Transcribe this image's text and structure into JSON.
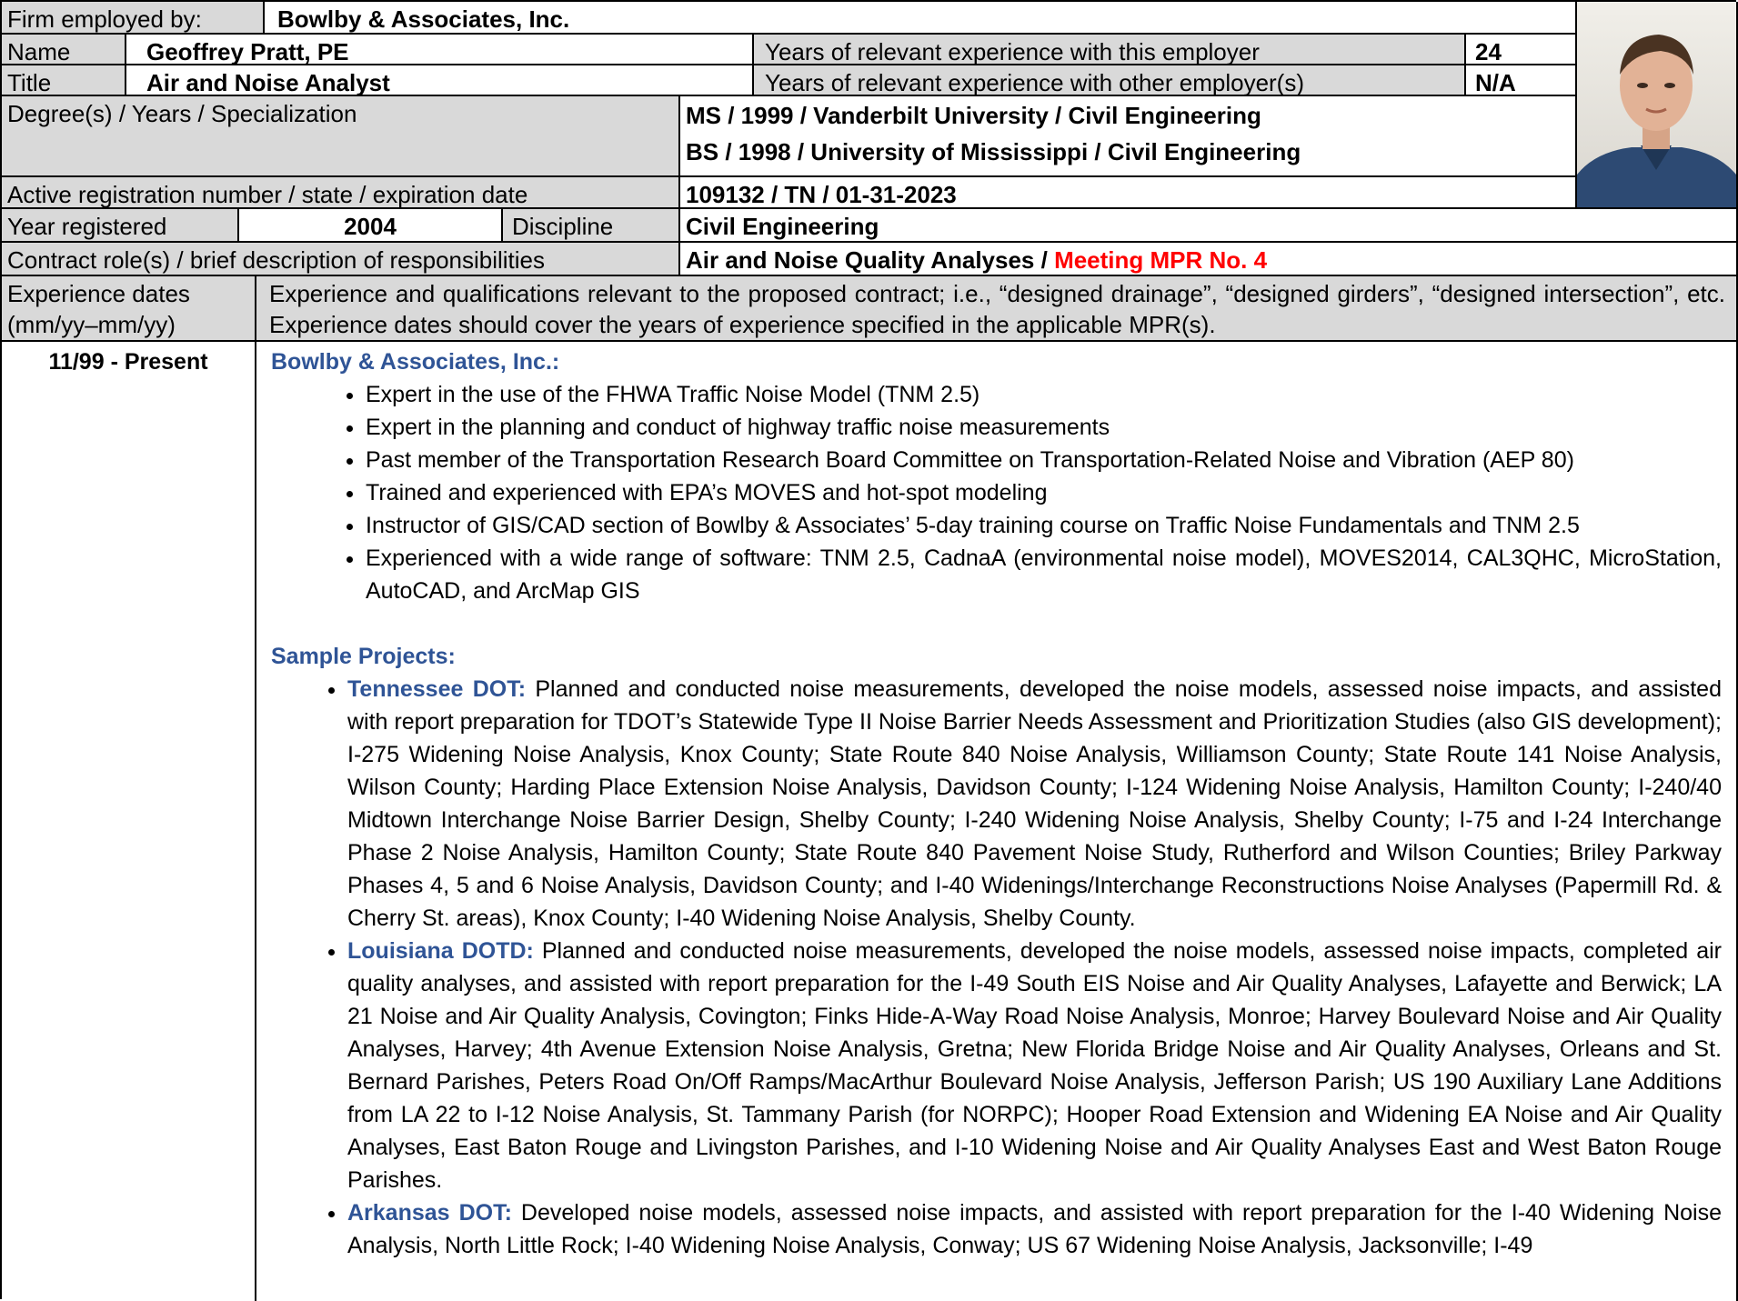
{
  "header": {
    "firm_label": "Firm employed by:",
    "firm_value": "Bowlby & Associates, Inc.",
    "name_label": "Name",
    "name_value": "Geoffrey Pratt, PE",
    "years_this_label": "Years of relevant experience with this employer",
    "years_this_value": "24",
    "title_label": "Title",
    "title_value": "Air and Noise Analyst",
    "years_other_label": "Years of relevant experience with other employer(s)",
    "years_other_value": "N/A",
    "degree_label": "Degree(s) / Years / Specialization",
    "degree_1": "MS / 1999 / Vanderbilt University / Civil Engineering",
    "degree_2": "BS / 1998 / University of Mississippi / Civil Engineering",
    "registration_label": "Active registration number / state / expiration date",
    "registration_value": "109132 / TN / 01-31-2023",
    "year_registered_label": "Year registered",
    "year_registered_value": "2004",
    "discipline_label": "Discipline",
    "discipline_value": "Civil Engineering",
    "role_label": "Contract role(s) / brief description of responsibilities",
    "role_value": "Air and Noise Quality Analyses / ",
    "role_mpr": "Meeting MPR No. 4",
    "exp_dates_label": "Experience dates (mm/yy–mm/yy)",
    "exp_desc_label": "Experience and qualifications relevant to the proposed contract; i.e., “designed drainage”, “designed girders”, “designed intersection”, etc.  Experience dates should cover the years of experience specified in the applicable MPR(s)."
  },
  "experience": {
    "dates": "11/99 - Present",
    "employer": "Bowlby & Associates, Inc.:",
    "bullets": [
      "Expert in the use of the FHWA Traffic Noise Model (TNM 2.5)",
      "Expert in the planning and conduct of highway traffic noise measurements",
      "Past member of the Transportation Research Board Committee on Transportation-Related Noise and Vibration (AEP 80)",
      "Trained and experienced with EPA’s MOVES and hot-spot modeling",
      "Instructor of GIS/CAD section of Bowlby & Associates’ 5-day training course on Traffic Noise Fundamentals and TNM 2.5",
      "Experienced with a wide range of software: TNM 2.5, CadnaA (environmental noise model), MOVES2014, CAL3QHC, MicroStation, AutoCAD, and ArcMap GIS"
    ],
    "sample_heading": "Sample Projects:",
    "projects": [
      {
        "client": "Tennessee DOT:",
        "text": " Planned and conducted noise measurements, developed the noise models, assessed noise impacts, and assisted with report preparation for TDOT’s Statewide Type II Noise Barrier Needs Assessment and Prioritization Studies (also GIS development); I-275 Widening Noise Analysis, Knox County; State Route 840 Noise Analysis, Williamson County; State Route 141 Noise Analysis, Wilson County;  Harding Place Extension Noise Analysis, Davidson County; I-124 Widening Noise Analysis, Hamilton County; I-240/40 Midtown Interchange Noise Barrier Design, Shelby County; I-240 Widening Noise Analysis, Shelby County; I-75 and I-24 Interchange Phase 2 Noise Analysis, Hamilton County; State Route 840 Pavement Noise Study, Rutherford and Wilson Counties; Briley Parkway Phases 4, 5 and 6 Noise Analysis, Davidson County; and I-40 Widenings/Interchange Reconstructions Noise Analyses (Papermill Rd. & Cherry St. areas), Knox County; I-40 Widening Noise Analysis, Shelby County."
      },
      {
        "client": "Louisiana DOTD:",
        "text": " Planned and conducted noise measurements, developed the noise models, assessed noise impacts, completed air quality analyses, and assisted with report preparation for the I-49 South EIS Noise and Air Quality Analyses, Lafayette and Berwick; LA 21 Noise and Air Quality Analysis, Covington; Finks Hide-A-Way Road Noise Analysis, Monroe; Harvey Boulevard Noise and Air Quality Analyses, Harvey; 4th Avenue Extension Noise Analysis, Gretna; New Florida Bridge Noise and Air Quality Analyses, Orleans and St. Bernard Parishes, Peters Road On/Off Ramps/MacArthur Boulevard Noise Analysis, Jefferson Parish; US 190 Auxiliary Lane Additions from LA 22 to I-12 Noise Analysis, St. Tammany Parish (for NORPC); Hooper Road Extension and Widening EA Noise and Air Quality Analyses, East Baton Rouge and Livingston Parishes, and I-10 Widening Noise and Air Quality Analyses East and West Baton Rouge Parishes."
      },
      {
        "client": "Arkansas DOT:",
        "text": " Developed noise models, assessed noise impacts, and assisted with report preparation for the I-40 Widening Noise Analysis, North Little Rock; I-40 Widening Noise Analysis, Conway; US 67 Widening Noise Analysis, Jacksonville; I-49"
      }
    ]
  },
  "colors": {
    "header_gray": "#d9d9d9",
    "accent_blue": "#2f5496",
    "mpr_red": "#ff0000"
  },
  "photo": {
    "icon": "portrait-photo"
  }
}
